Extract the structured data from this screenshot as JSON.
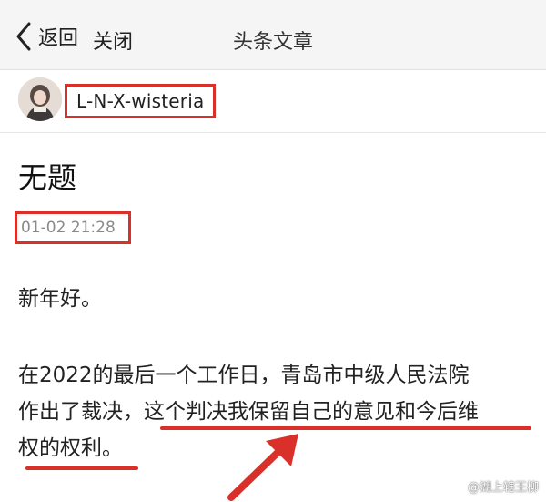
{
  "topbar": {
    "back_label": "返回",
    "close_label": "关闭",
    "title": "头条文章"
  },
  "author": {
    "name": "L-N-X-wisteria"
  },
  "article": {
    "title": "无题",
    "date": "01-02 21:28",
    "para1": "新年好。",
    "para2_line1": "在2022的最后一个工作日，青岛市中级人民法院",
    "para2_line2_prefix": "作出了裁决，",
    "para2_line2_highlight": "这个判决我保留自己的意见和今后维",
    "para2_line3": "权的权利。"
  },
  "watermark": {
    "text": "@湖上辖王柳"
  },
  "colors": {
    "annotation_red": "#d9302a",
    "topbar_bg": "#f5f5f5",
    "date_gray": "#8a8a8a"
  }
}
